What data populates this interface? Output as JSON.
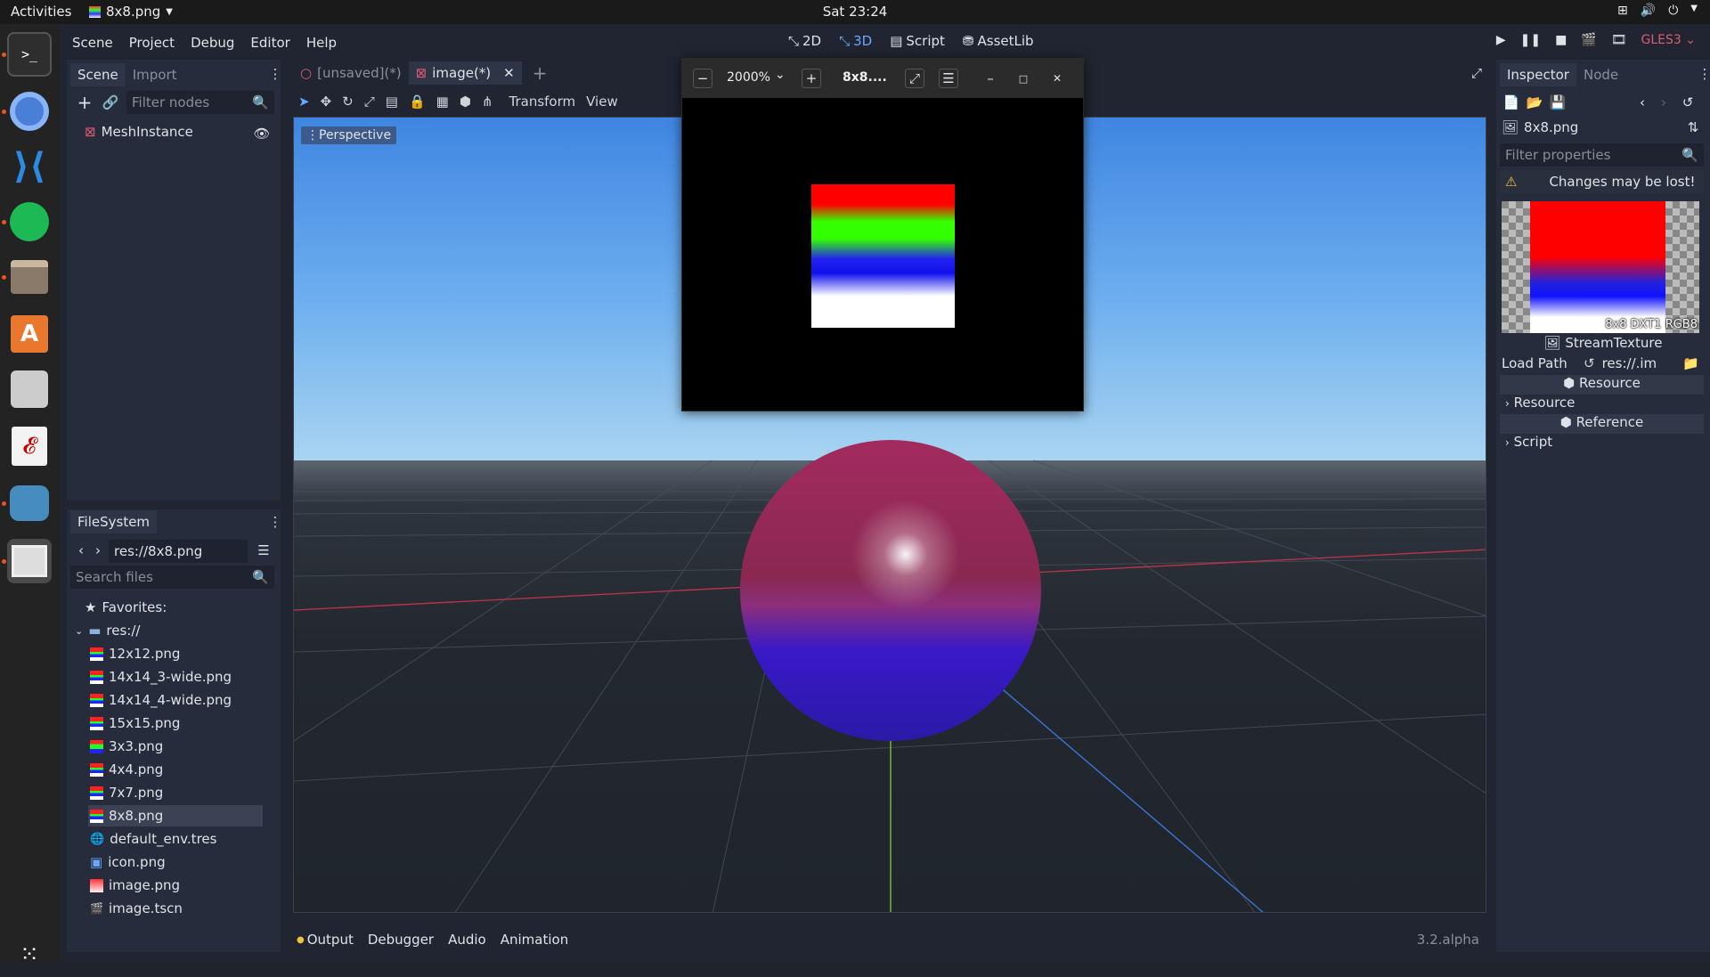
{
  "topbar": {
    "activities": "Activities",
    "app_name": "8x8.png",
    "clock": "Sat 23:24"
  },
  "menubar": {
    "items": [
      "Scene",
      "Project",
      "Debug",
      "Editor",
      "Help"
    ],
    "modes": [
      "2D",
      "3D",
      "Script",
      "AssetLib"
    ],
    "renderer": "GLES3"
  },
  "scene_panel": {
    "tabs": [
      "Scene",
      "Import"
    ],
    "filter_placeholder": "Filter nodes",
    "root_node": "MeshInstance"
  },
  "filesystem": {
    "title": "FileSystem",
    "path": "res://8x8.png",
    "search_placeholder": "Search files",
    "favorites": "Favorites:",
    "root": "res://",
    "files": [
      {
        "name": "12x12.png",
        "thumb": "stripes"
      },
      {
        "name": "14x14_3-wide.png",
        "thumb": "stripes"
      },
      {
        "name": "14x14_4-wide.png",
        "thumb": "stripes"
      },
      {
        "name": "15x15.png",
        "thumb": "stripes"
      },
      {
        "name": "3x3.png",
        "thumb": "g"
      },
      {
        "name": "4x4.png",
        "thumb": "stripes"
      },
      {
        "name": "7x7.png",
        "thumb": "stripes"
      },
      {
        "name": "8x8.png",
        "thumb": "stripes"
      },
      {
        "name": "default_env.tres",
        "thumb": "globe"
      },
      {
        "name": "icon.png",
        "thumb": "godot"
      },
      {
        "name": "image.png",
        "thumb": "red"
      },
      {
        "name": "image.tscn",
        "thumb": "scene"
      }
    ],
    "selected": "8x8.png"
  },
  "editor_tabs": [
    "[unsaved](*)",
    "image(*)"
  ],
  "viewport_toolbar": {
    "transform": "Transform",
    "view": "View"
  },
  "viewport": {
    "perspective": "Perspective"
  },
  "image_viewer": {
    "zoom": "2000%",
    "title": "8x8...."
  },
  "inspector": {
    "tabs": [
      "Inspector",
      "Node"
    ],
    "resource_name": "8x8.png",
    "filter_placeholder": "Filter properties",
    "warning": "Changes may be lost!",
    "preview_info": "8x8 DXT1 RGB8",
    "class_name": "StreamTexture",
    "load_path_label": "Load Path",
    "load_path_value": "res://.im",
    "section_resource": "Resource",
    "group_resource": "Resource",
    "section_reference": "Reference",
    "group_script": "Script"
  },
  "bottom_panel": {
    "tabs": [
      "Output",
      "Debugger",
      "Audio",
      "Animation"
    ],
    "version": "3.2.alpha"
  }
}
